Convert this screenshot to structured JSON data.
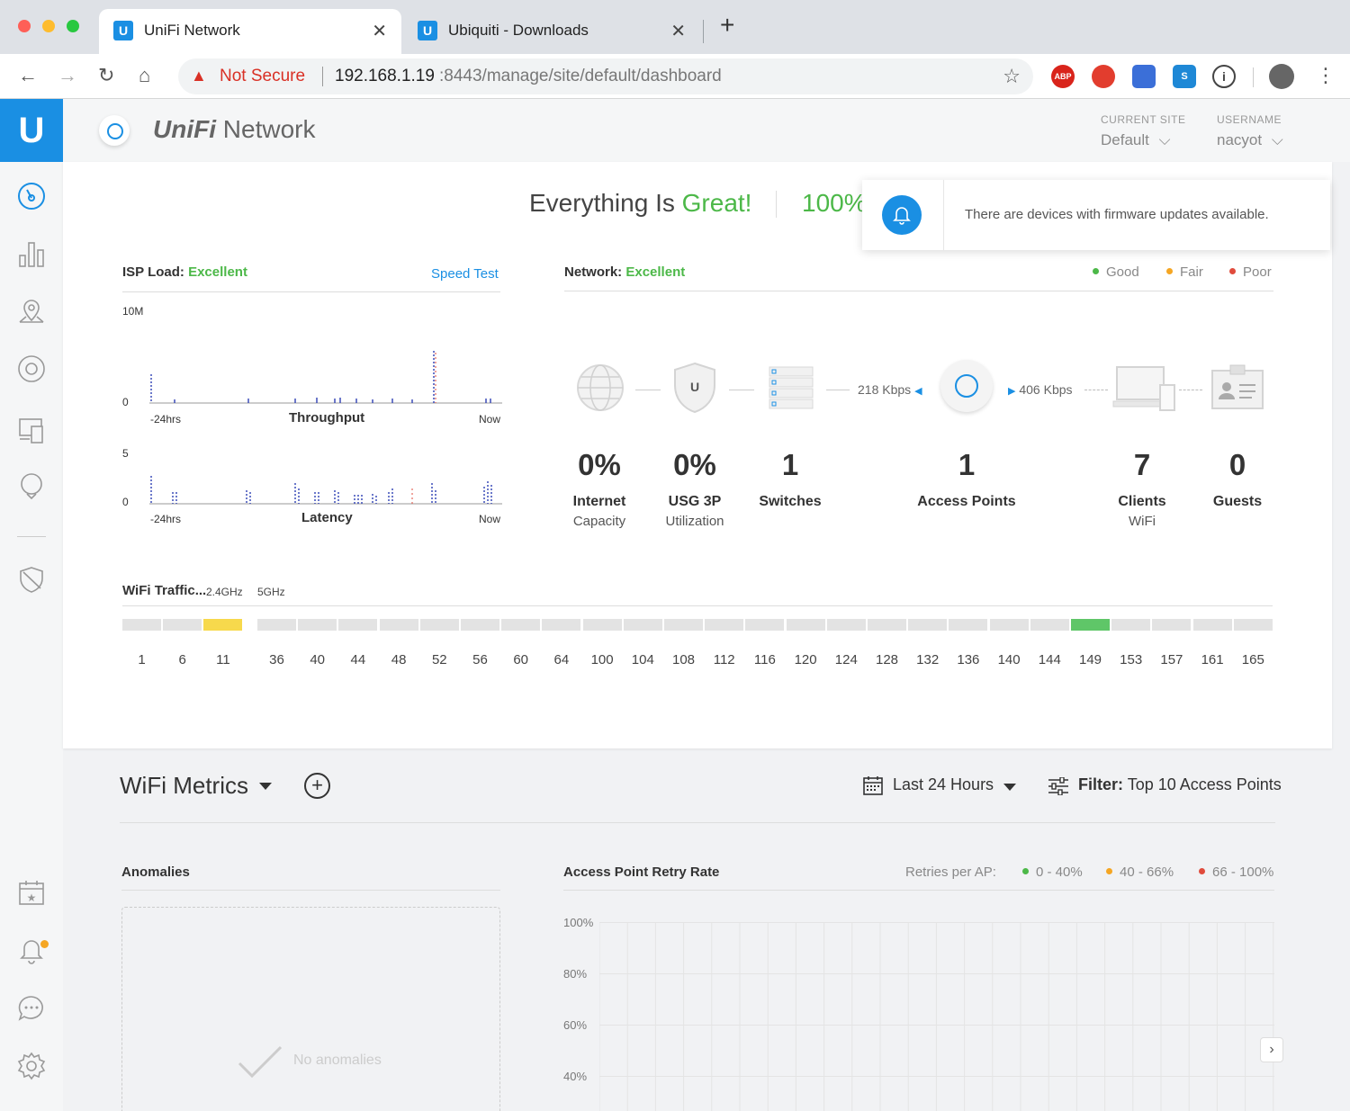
{
  "browser": {
    "tabs": [
      {
        "title": "UniFi Network",
        "favicon": "U",
        "active": true
      },
      {
        "title": "Ubiquiti - Downloads",
        "favicon": "U",
        "active": false
      }
    ],
    "security_label": "Not Secure",
    "url_host": "192.168.1.19",
    "url_path": ":8443/manage/site/default/dashboard",
    "extensions": [
      {
        "name": "adblock-plus-icon",
        "label": "ABP",
        "color": "#d9241b"
      },
      {
        "name": "ext-red-icon",
        "label": "",
        "color": "#e23d2e"
      },
      {
        "name": "ext-lighthouse-icon",
        "label": "",
        "color": "#3b6fd8"
      },
      {
        "name": "ext-s-icon",
        "label": "S",
        "color": "#1e88d6"
      },
      {
        "name": "ext-info-icon",
        "label": "ⓘ",
        "color": "#555555"
      }
    ]
  },
  "header": {
    "app_name_prefix": "UniFi",
    "app_name_suffix": " Network",
    "site_label": "CURRENT SITE",
    "site_value": "Default",
    "user_label": "USERNAME",
    "user_value": "nacyot"
  },
  "status": {
    "prefix": "Everything Is ",
    "highlight": "Great!",
    "percent": "100%"
  },
  "notification": {
    "text": "There are devices with firmware updates available."
  },
  "isp": {
    "title": "ISP Load:",
    "state": "Excellent",
    "speed_test": "Speed Test",
    "throughput": {
      "label": "Throughput",
      "max": "10M",
      "min": "0",
      "start": "-24hrs",
      "end": "Now"
    },
    "latency": {
      "label": "Latency",
      "max": "5",
      "min": "0",
      "start": "-24hrs",
      "end": "Now"
    }
  },
  "network": {
    "title": "Network:",
    "state": "Excellent",
    "legend": [
      {
        "label": "Good",
        "color": "#4cb848"
      },
      {
        "label": "Fair",
        "color": "#f5a623"
      },
      {
        "label": "Poor",
        "color": "#e04b3c"
      }
    ],
    "rates": {
      "down": "218 Kbps",
      "up": "406 Kbps"
    },
    "stats": [
      {
        "value": "0%",
        "label": "Internet",
        "sub": "Capacity"
      },
      {
        "value": "0%",
        "label": "USG 3P",
        "sub": "Utilization"
      },
      {
        "value": "1",
        "label": "Switches",
        "sub": ""
      },
      {
        "value": "1",
        "label": "Access Points",
        "sub": ""
      },
      {
        "value": "7",
        "label": "Clients",
        "sub": "WiFi"
      },
      {
        "value": "0",
        "label": "Guests",
        "sub": ""
      }
    ]
  },
  "wifi_traffic": {
    "title": "WiFi Traffic...",
    "band_24": "2.4GHz",
    "band_5": "5GHz",
    "channels_24": [
      "1",
      "6",
      "11"
    ],
    "channels_5": [
      "36",
      "40",
      "44",
      "48",
      "52",
      "56",
      "60",
      "64",
      "100",
      "104",
      "108",
      "112",
      "116",
      "120",
      "124",
      "128",
      "132",
      "136",
      "140",
      "144",
      "149",
      "153",
      "157",
      "161",
      "165"
    ],
    "active_24": "11",
    "active_5": "149",
    "color_24": "#f7d94c",
    "color_5": "#5fc668"
  },
  "wifi_metrics": {
    "title": "WiFi Metrics",
    "range": "Last 24 Hours",
    "filter_label": "Filter:",
    "filter_value": " Top 10 Access Points",
    "anomalies_title": "Anomalies",
    "no_anomalies": "No anomalies",
    "retry_title": "Access Point Retry Rate",
    "retry_legend_label": "Retries per AP:",
    "retry_legend": [
      {
        "label": "0 - 40%",
        "color": "#4cb848"
      },
      {
        "label": "40 - 66%",
        "color": "#f5a623"
      },
      {
        "label": "66 - 100%",
        "color": "#e04b3c"
      }
    ],
    "y_ticks": [
      "100%",
      "80%",
      "60%",
      "40%"
    ]
  }
}
